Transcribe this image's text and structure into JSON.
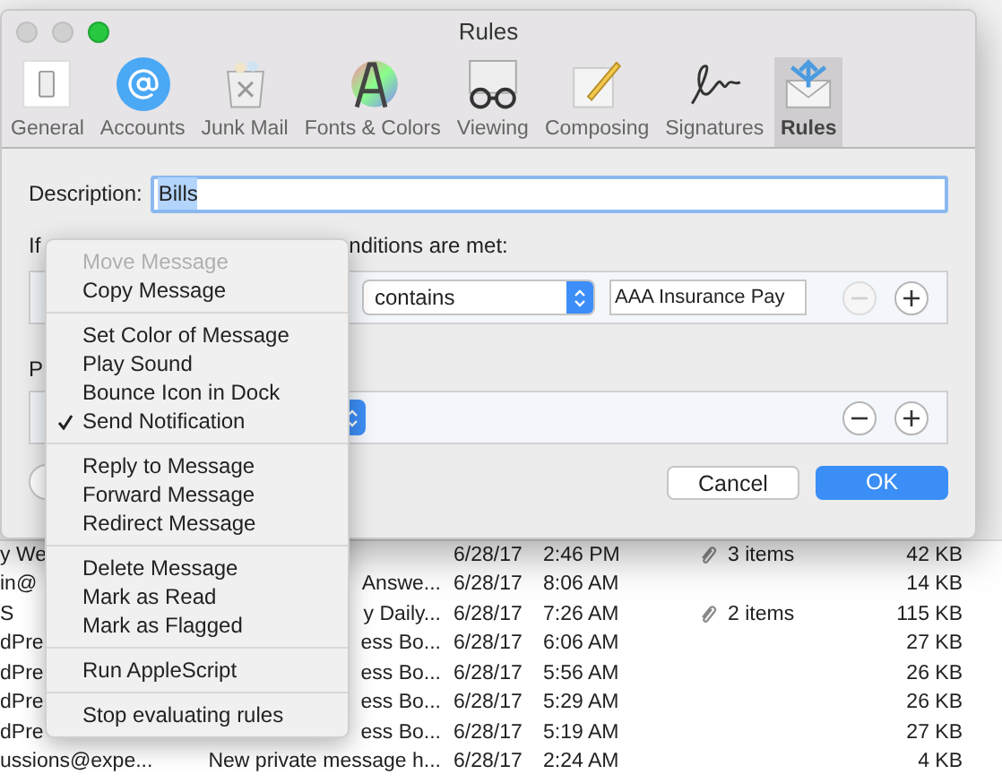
{
  "window": {
    "title": "Rules"
  },
  "toolbar": [
    {
      "label": "General",
      "selected": false
    },
    {
      "label": "Accounts",
      "selected": false
    },
    {
      "label": "Junk Mail",
      "selected": false
    },
    {
      "label": "Fonts & Colors",
      "selected": false
    },
    {
      "label": "Viewing",
      "selected": false
    },
    {
      "label": "Composing",
      "selected": false
    },
    {
      "label": "Signatures",
      "selected": false
    },
    {
      "label": "Rules",
      "selected": true
    }
  ],
  "rule_sheet": {
    "description_label": "Description:",
    "description_value": "Bills",
    "if_label": "If",
    "conditions_tail": "nditions are met:",
    "condition": {
      "operator": "contains",
      "value": "AAA Insurance Pay",
      "remove_disabled": true
    },
    "perform_label": "P",
    "action": {
      "remove_disabled": false
    },
    "buttons": [
      {
        "label": "Cancel",
        "default": false
      },
      {
        "label": "OK",
        "default": true
      }
    ]
  },
  "action_menu": {
    "groups": [
      [
        {
          "label": "Move Message",
          "disabled": true,
          "checked": false
        },
        {
          "label": "Copy Message",
          "disabled": false,
          "checked": false
        }
      ],
      [
        {
          "label": "Set Color of Message",
          "disabled": false,
          "checked": false
        },
        {
          "label": "Play Sound",
          "disabled": false,
          "checked": false
        },
        {
          "label": "Bounce Icon in Dock",
          "disabled": false,
          "checked": false
        },
        {
          "label": "Send Notification",
          "disabled": false,
          "checked": true
        }
      ],
      [
        {
          "label": "Reply to Message",
          "disabled": false,
          "checked": false
        },
        {
          "label": "Forward Message",
          "disabled": false,
          "checked": false
        },
        {
          "label": "Redirect Message",
          "disabled": false,
          "checked": false
        }
      ],
      [
        {
          "label": "Delete Message",
          "disabled": false,
          "checked": false
        },
        {
          "label": "Mark as Read",
          "disabled": false,
          "checked": false
        },
        {
          "label": "Mark as Flagged",
          "disabled": false,
          "checked": false
        }
      ],
      [
        {
          "label": "Run AppleScript",
          "disabled": false,
          "checked": false
        }
      ],
      [
        {
          "label": "Stop evaluating rules",
          "disabled": false,
          "checked": false
        }
      ]
    ]
  },
  "message_list": {
    "rows": [
      {
        "from": "y We",
        "subject": "",
        "date": "6/28/17",
        "time": "2:46 PM",
        "attachments": "3 items",
        "size": "42 KB"
      },
      {
        "from": "in@",
        "subject": "Answe...",
        "date": "6/28/17",
        "time": "8:06 AM",
        "attachments": "",
        "size": "14 KB"
      },
      {
        "from": "S",
        "subject": "y Daily...",
        "date": "6/28/17",
        "time": "7:26 AM",
        "attachments": "2 items",
        "size": "115 KB"
      },
      {
        "from": "dPre",
        "subject": "ess Bo...",
        "date": "6/28/17",
        "time": "6:06 AM",
        "attachments": "",
        "size": "27 KB"
      },
      {
        "from": "dPre",
        "subject": "ess Bo...",
        "date": "6/28/17",
        "time": "5:56 AM",
        "attachments": "",
        "size": "26 KB"
      },
      {
        "from": "dPre",
        "subject": "ess Bo...",
        "date": "6/28/17",
        "time": "5:29 AM",
        "attachments": "",
        "size": "26 KB"
      },
      {
        "from": "dPre",
        "subject": "ess Bo...",
        "date": "6/28/17",
        "time": "5:19 AM",
        "attachments": "",
        "size": "27 KB"
      },
      {
        "from": "ussions@expe...",
        "subject": "New private message h...",
        "date": "6/28/17",
        "time": "2:24 AM",
        "attachments": "",
        "size": "4 KB"
      }
    ]
  }
}
